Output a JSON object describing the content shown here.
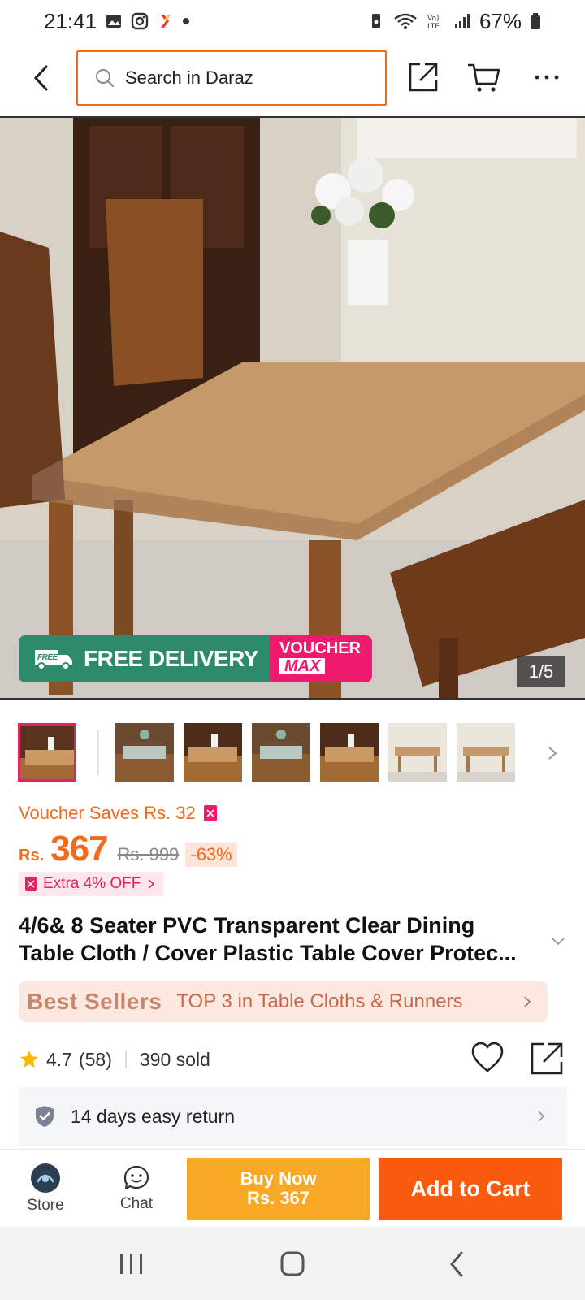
{
  "status_bar": {
    "time": "21:41",
    "battery": "67%"
  },
  "search": {
    "placeholder": "Search in Daraz"
  },
  "gallery": {
    "counter": "1/5",
    "free_delivery_label": "FREE DELIVERY",
    "free_tag": "FREE",
    "voucher_label": "VOUCHER",
    "voucher_max_label": "MAX",
    "thumbnail_count": 7,
    "selected_index": 0
  },
  "pricing": {
    "voucher_saves": "Voucher Saves Rs. 32",
    "currency": "Rs.",
    "price": "367",
    "original_price": "Rs. 999",
    "discount": "-63%",
    "extra_off": "Extra 4% OFF"
  },
  "product": {
    "title_line1": "4/6& 8 Seater PVC Transparent Clear Dining",
    "title_line2": "Table Cloth / Cover Plastic Table Cover Protec..."
  },
  "best_sellers": {
    "logo": "Best Sellers",
    "text": "TOP 3 in Table Cloths & Runners"
  },
  "stats": {
    "rating": "4.7",
    "reviews": "(58)",
    "sold": "390 sold"
  },
  "returns": {
    "text": "14 days easy return"
  },
  "action_bar": {
    "store_label": "Store",
    "chat_label": "Chat",
    "buy_now_label": "Buy Now",
    "buy_now_price": "Rs. 367",
    "add_to_cart_label": "Add to Cart"
  },
  "colors": {
    "brand_orange": "#f85a0e",
    "buy_now_yellow": "#f9a825",
    "free_delivery_green": "#2d8a6a",
    "voucher_pink": "#ee1a6e"
  }
}
